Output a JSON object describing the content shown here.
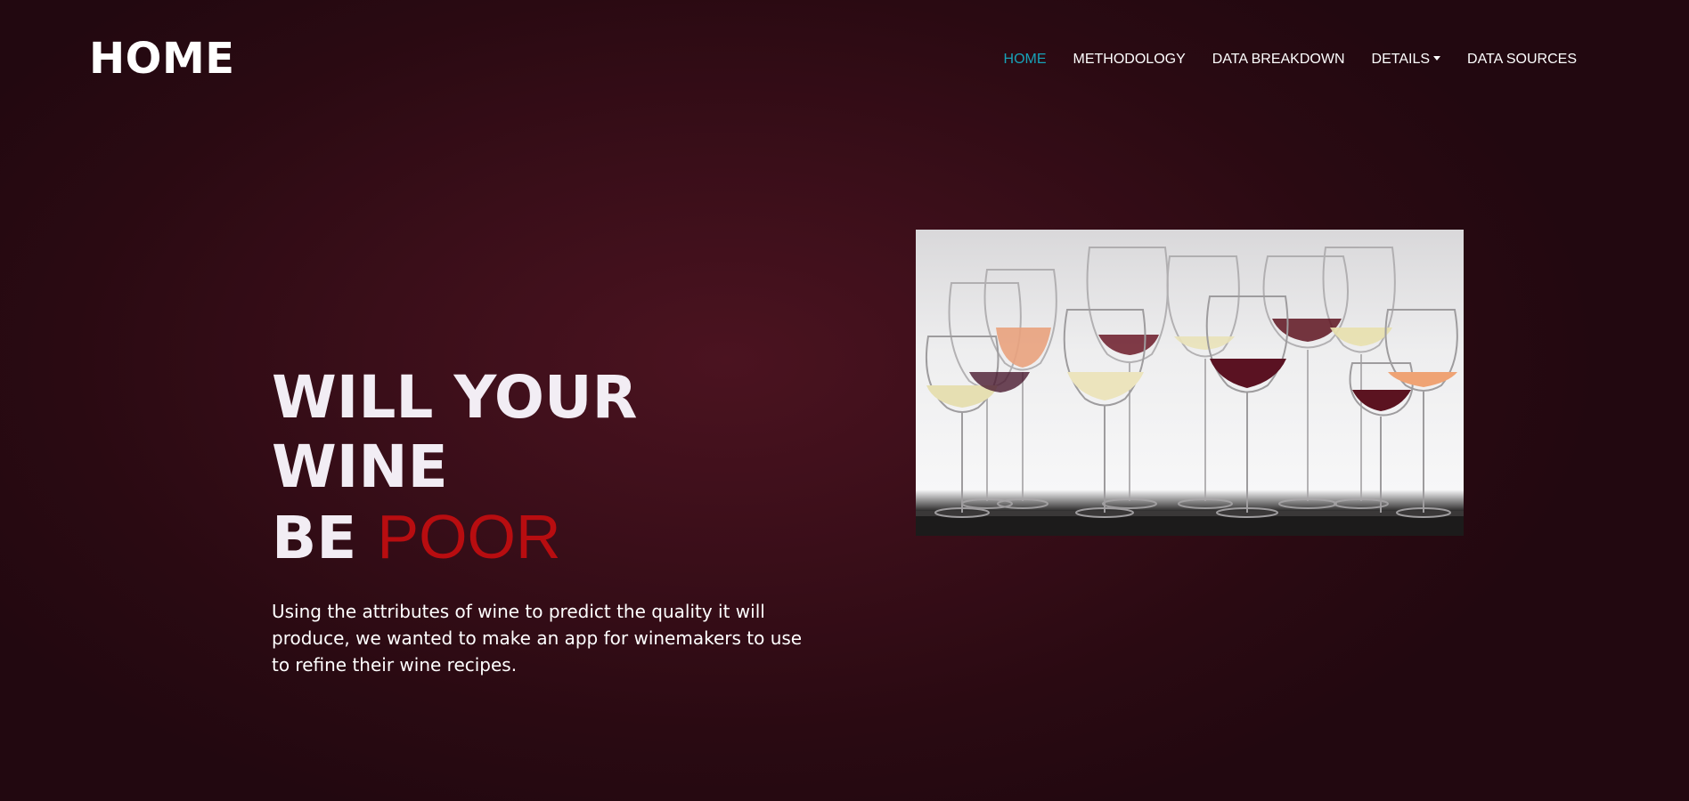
{
  "header": {
    "brand": "HOME",
    "nav": [
      {
        "label": "HOME",
        "active": true
      },
      {
        "label": "METHODOLOGY"
      },
      {
        "label": "DATA BREAKDOWN"
      },
      {
        "label": "DETAILS",
        "dropdown": true
      },
      {
        "label": "DATA SOURCES"
      }
    ]
  },
  "hero": {
    "headline_line1": "WILL YOUR WINE",
    "headline_line2_prefix": "BE",
    "headline_accent": "POOR",
    "description": "Using the attributes of wine to predict the quality it will produce, we wanted to make an app for winemakers to use to refine their wine recipes."
  },
  "colors": {
    "active_nav": "#17a2b8",
    "accent": "#b80d10",
    "background": "#3a0e19"
  }
}
